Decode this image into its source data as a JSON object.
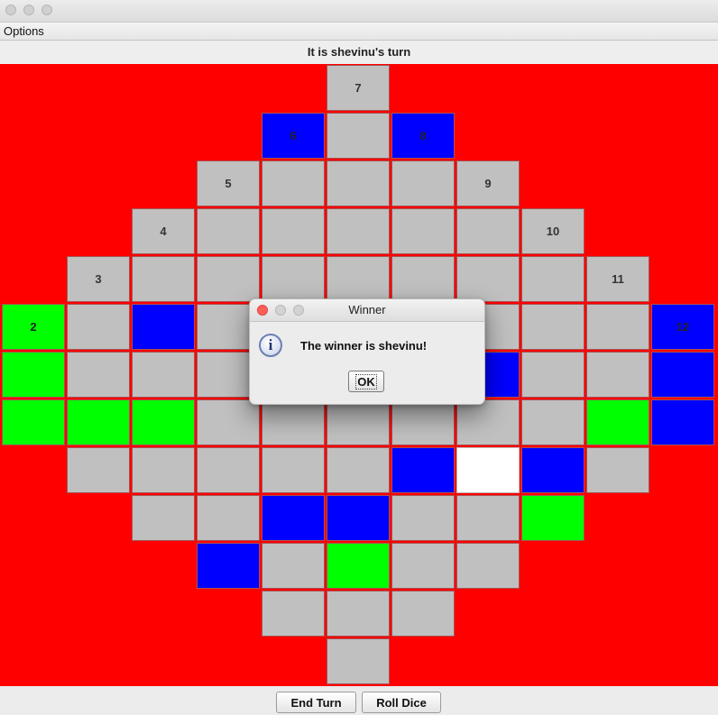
{
  "window": {
    "traffic_lights": [
      "close",
      "minimize",
      "zoom"
    ]
  },
  "menu": {
    "options_label": "Options"
  },
  "status": {
    "turn_text": "It is shevinu's turn"
  },
  "board": {
    "colors": {
      "background": "#ff0000",
      "empty": "#c0c0c0",
      "blue": "#0000ff",
      "green": "#00ff00",
      "highlight": "#ffffff"
    },
    "columns": [
      {
        "label": "2",
        "cells": [
          "green",
          "green",
          "green"
        ]
      },
      {
        "label": "3",
        "cells": [
          "empty",
          "empty",
          "empty",
          "green",
          "empty"
        ]
      },
      {
        "label": "4",
        "cells": [
          "empty",
          "empty",
          "blue",
          "empty",
          "green",
          "empty",
          "empty"
        ]
      },
      {
        "label": "5",
        "cells": [
          "empty",
          "empty",
          "empty",
          "empty",
          "empty",
          "empty",
          "empty",
          "empty",
          "blue"
        ]
      },
      {
        "label": "6",
        "cells": [
          "blue",
          "empty",
          "empty",
          "empty",
          "empty",
          "empty",
          "empty",
          "empty",
          "blue",
          "empty",
          "empty"
        ]
      },
      {
        "label": "7",
        "cells": [
          "empty",
          "empty",
          "empty",
          "empty",
          "empty",
          "empty",
          "empty",
          "empty",
          "empty",
          "blue",
          "green",
          "empty",
          "empty"
        ]
      },
      {
        "label": "8",
        "cells": [
          "blue",
          "empty",
          "empty",
          "empty",
          "empty",
          "empty",
          "empty",
          "blue",
          "empty",
          "empty",
          "empty"
        ]
      },
      {
        "label": "9",
        "cells": [
          "empty",
          "empty",
          "empty",
          "empty",
          "blue",
          "empty",
          "white",
          "empty",
          "empty"
        ]
      },
      {
        "label": "10",
        "cells": [
          "empty",
          "empty",
          "empty",
          "empty",
          "empty",
          "blue",
          "green"
        ]
      },
      {
        "label": "11",
        "cells": [
          "empty",
          "empty",
          "empty",
          "green",
          "empty"
        ]
      },
      {
        "label": "12",
        "cells": [
          "blue",
          "blue",
          "blue"
        ]
      }
    ]
  },
  "buttons": {
    "end_turn": "End Turn",
    "roll_dice": "Roll Dice"
  },
  "dialog": {
    "title": "Winner",
    "icon": "info-icon",
    "message": "The winner is shevinu!",
    "ok_label": "OK"
  }
}
